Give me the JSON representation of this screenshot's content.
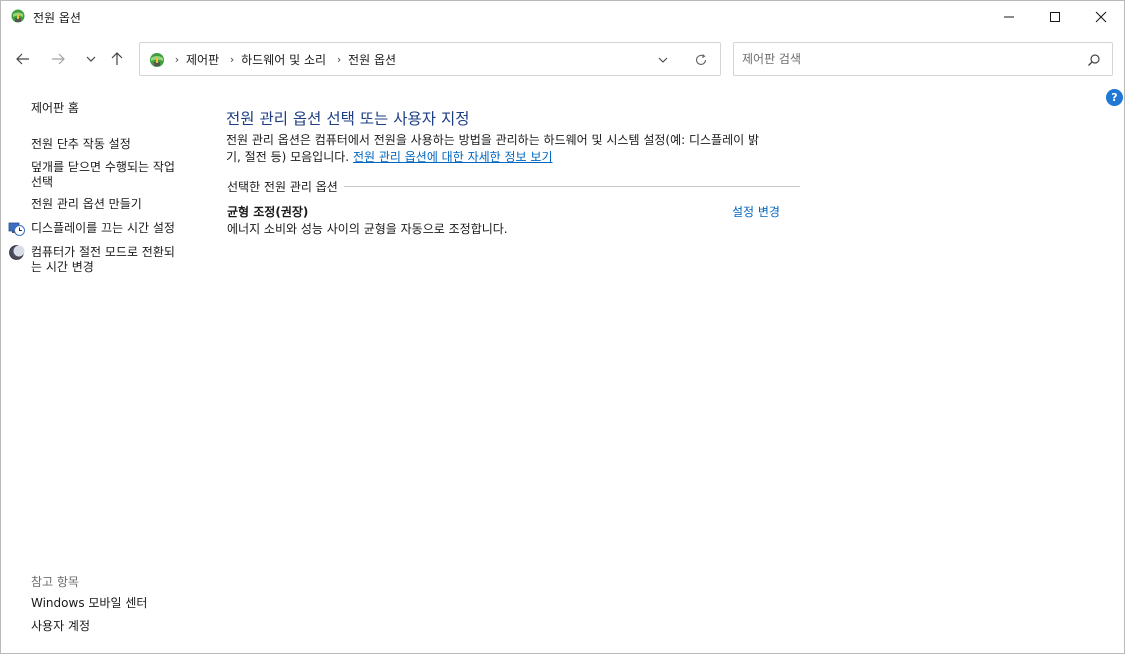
{
  "window": {
    "title": "전원 옵션"
  },
  "nav": {
    "breadcrumbs": [
      "제어판",
      "하드웨어 및 소리",
      "전원 옵션"
    ],
    "search_placeholder": "제어판 검색"
  },
  "sidebar": {
    "home": "제어판 홈",
    "tasks": [
      {
        "label_lines": [
          "전원 단추 작동 설정"
        ]
      },
      {
        "label_lines": [
          "덮개를 닫으면 수행되는 작업",
          "선택"
        ]
      },
      {
        "label_lines": [
          "전원 관리 옵션 만들기"
        ]
      },
      {
        "label_lines": [
          "디스플레이를 끄는 시간 설정"
        ],
        "icon": "display-clock-icon"
      },
      {
        "label_lines": [
          "컴퓨터가 절전 모드로 전환되",
          "는 시간 변경"
        ],
        "icon": "moon-icon"
      }
    ],
    "see_also_label": "참고 항목",
    "see_also": [
      "Windows 모바일 센터",
      "사용자 계정"
    ]
  },
  "main": {
    "title": "전원 관리 옵션 선택 또는 사용자 지정",
    "description_line1": "전원 관리 옵션은 컴퓨터에서 전원을 사용하는 방법을 관리하는 하드웨어 및 시스템 설정(예: 디스플레이 밝",
    "description_line2": "기, 절전 등) 모음입니다.",
    "description_link": "전원 관리 옵션에 대한 자세한 정보 보기",
    "section_label": "선택한 전원 관리 옵션",
    "plan": {
      "name": "균형 조정(권장)",
      "description": "에너지 소비와 성능 사이의 균형을 자동으로 조정합니다.",
      "change_link": "설정 변경"
    }
  },
  "help_glyph": "?",
  "colors": {
    "title_blue": "#1e3f86",
    "link_blue": "#0067c0",
    "help_blue": "#1e78d4"
  }
}
